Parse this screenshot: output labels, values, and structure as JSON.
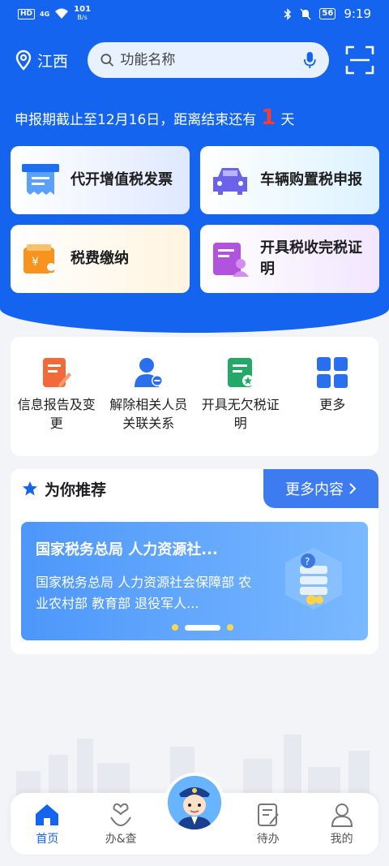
{
  "status_bar": {
    "hd": "HD",
    "network": "4G",
    "speed_value": "101",
    "speed_unit": "B/s",
    "battery": "56",
    "time": "9:19"
  },
  "header": {
    "location": "江西",
    "search_placeholder": "功能名称"
  },
  "deadline": {
    "prefix": "申报期截止至12月16日，距离结束还有",
    "days": "1",
    "suffix": "天"
  },
  "main_cards": [
    {
      "label": "代开增值税发票",
      "icon": "invoice-icon",
      "color": "#1e6ff0"
    },
    {
      "label": "车辆购置税申报",
      "icon": "car-icon",
      "color": "#6a63ea"
    },
    {
      "label": "税费缴纳",
      "icon": "wallet-icon",
      "color": "#f7931e"
    },
    {
      "label": "开具税收完税证明",
      "icon": "certificate-icon",
      "color": "#b253dd"
    }
  ],
  "quick_actions": [
    {
      "label": "信息报告及变更",
      "icon": "edit-doc-icon",
      "color": "#f36a3a"
    },
    {
      "label": "解除相关人员关联关系",
      "icon": "user-remove-icon",
      "color": "#2a6fee"
    },
    {
      "label": "开具无欠税证明",
      "icon": "doc-star-icon",
      "color": "#22a867"
    },
    {
      "label": "更多",
      "icon": "grid-icon",
      "color": "#2a6fee"
    }
  ],
  "recommend": {
    "title": "为你推荐",
    "more": "更多内容",
    "banner_title": "国家税务总局 人力资源社...",
    "banner_desc": "国家税务总局 人力资源社会保障部 农业农村部 教育部 退役军人..."
  },
  "tabs": [
    {
      "label": "首页",
      "icon": "home-icon"
    },
    {
      "label": "办&查",
      "icon": "heart-hand-icon"
    },
    {
      "label": "",
      "icon": "tax-officer-avatar-icon"
    },
    {
      "label": "待办",
      "icon": "todo-doc-icon"
    },
    {
      "label": "我的",
      "icon": "profile-icon"
    }
  ],
  "colors": {
    "primary": "#1464f0",
    "deadline_number": "#ff3b30",
    "banner": "#4d97fb"
  }
}
